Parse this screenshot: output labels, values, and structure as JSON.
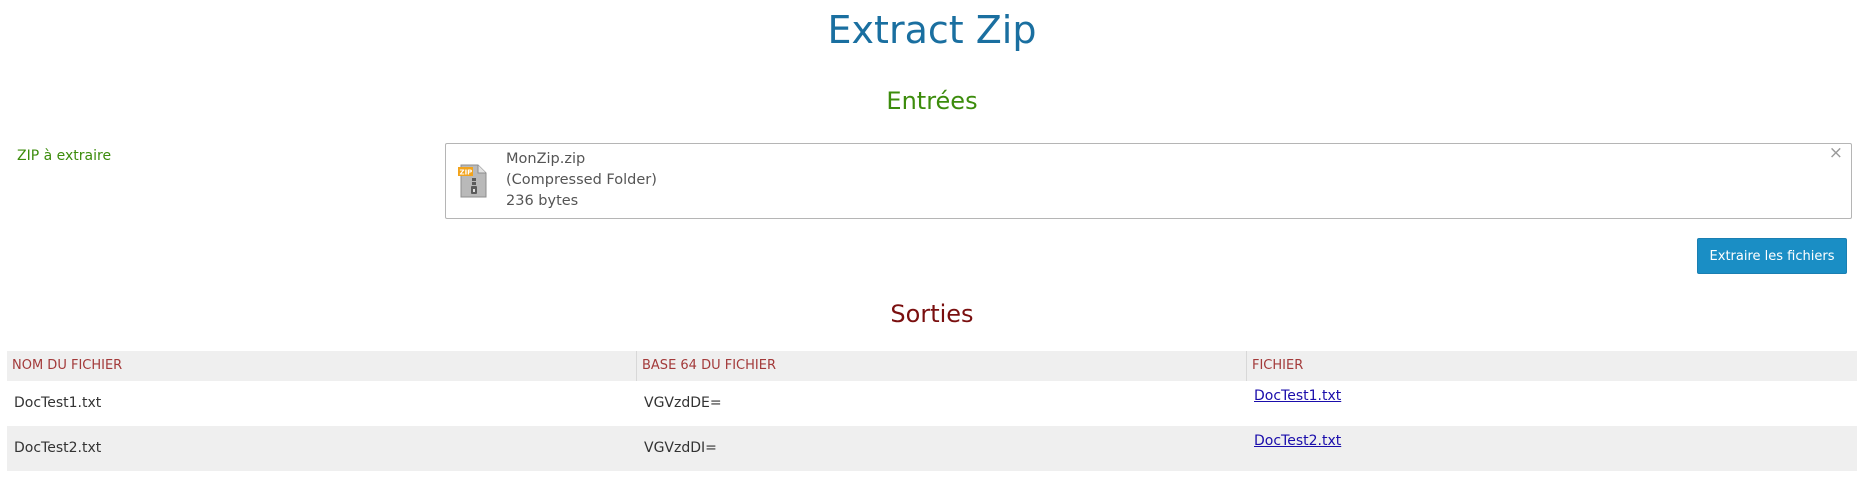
{
  "page": {
    "title": "Extract Zip"
  },
  "inputs": {
    "heading": "Entrées",
    "zip_field": {
      "label": "ZIP à extraire",
      "file_name": "MonZip.zip",
      "file_type": "(Compressed Folder)",
      "file_size": "236 bytes",
      "icon": "zip-file-icon",
      "remove_glyph": "×"
    },
    "extract_button": "Extraire les fichiers"
  },
  "outputs": {
    "heading": "Sorties",
    "columns": [
      "NOM DU FICHIER",
      "BASE 64 DU FICHIER",
      "FICHIER"
    ],
    "rows": [
      {
        "name": "DocTest1.txt",
        "base64": "VGVzdDE=",
        "link": "DocTest1.txt"
      },
      {
        "name": "DocTest2.txt",
        "base64": "VGVzdDI=",
        "link": "DocTest2.txt"
      }
    ]
  },
  "colors": {
    "title": "#1a6fa0",
    "inputs_heading": "#3c8c0c",
    "outputs_heading": "#7a0f0f",
    "button_bg": "#1a8ec5",
    "table_header_text": "#a33a3a",
    "link": "#1a0dab"
  }
}
